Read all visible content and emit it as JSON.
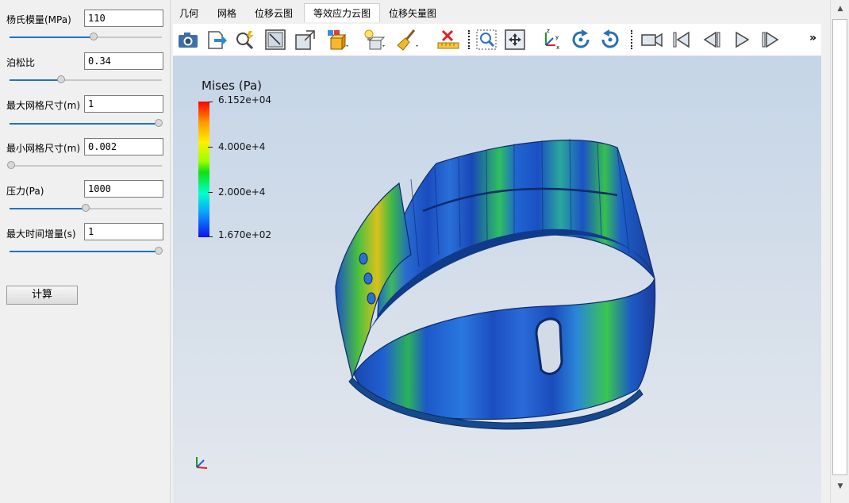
{
  "params": [
    {
      "label": "杨氏模量(MPa)",
      "value": "110",
      "slider": 0.55
    },
    {
      "label": "泊松比",
      "value": "0.34",
      "slider": 0.34
    },
    {
      "label": "最大网格尺寸(m)",
      "value": "1",
      "slider": 1.0
    },
    {
      "label": "最小网格尺寸(m)",
      "value": "0.002",
      "slider": 0.0
    },
    {
      "label": "压力(Pa)",
      "value": "1000",
      "slider": 0.5
    },
    {
      "label": "最大时间增量(s)",
      "value": "1",
      "slider": 1.0
    }
  ],
  "calc_button": "计算",
  "tabs": [
    {
      "label": "几何",
      "active": false
    },
    {
      "label": "网格",
      "active": false
    },
    {
      "label": "位移云图",
      "active": false
    },
    {
      "label": "等效应力云图",
      "active": true
    },
    {
      "label": "位移矢量图",
      "active": false
    }
  ],
  "toolbar": {
    "icons": [
      "screenshot-icon",
      "export-icon",
      "zoom-pick-icon",
      "fit-view-icon",
      "front-view-icon",
      "display-mode-icon",
      "lighting-icon",
      "clean-brush-icon",
      "ruler-delete-icon",
      "zoom-box-icon",
      "fit-all-icon",
      "axes-icon",
      "rotate-cw-icon",
      "rotate-ccw-icon",
      "camera-record-icon",
      "first-frame-icon",
      "prev-frame-icon",
      "play-icon",
      "last-frame-icon"
    ],
    "more": "»"
  },
  "colorbar": {
    "title": "Mises (Pa)",
    "max": "6.152e+04",
    "tick1": "4.000e+4",
    "tick2": "2.000e+4",
    "min": "1.670e+02"
  },
  "triad": {
    "z": "z",
    "y": "y",
    "x": "x"
  }
}
